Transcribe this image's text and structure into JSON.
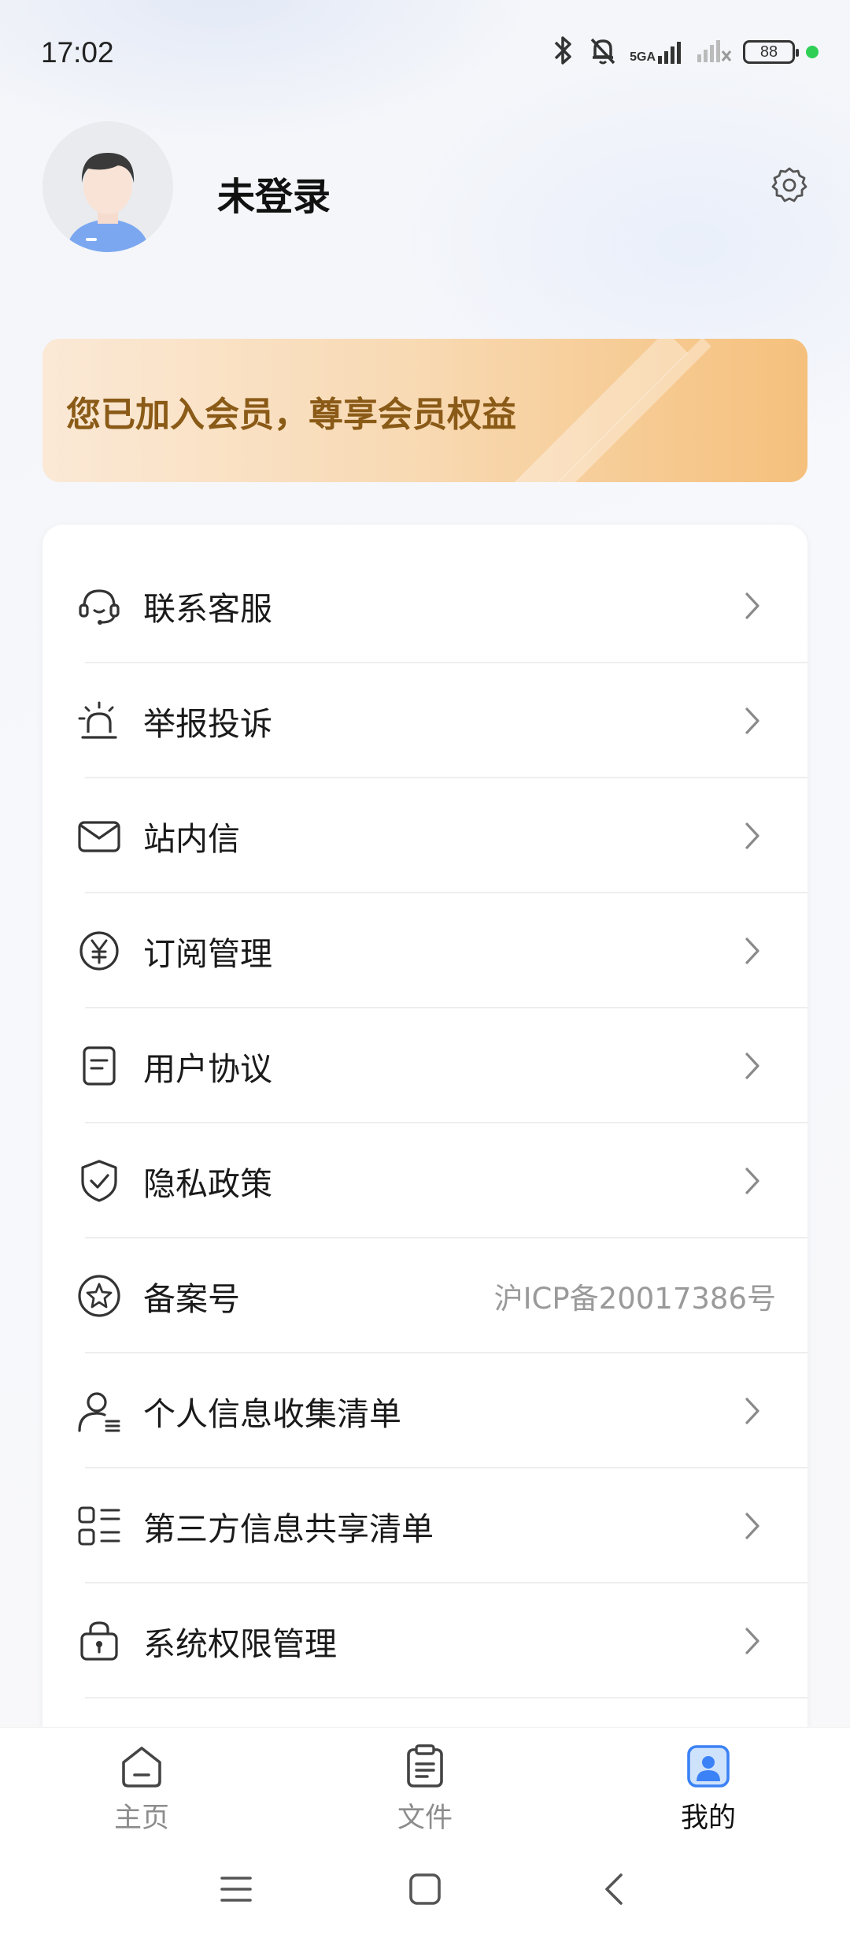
{
  "status_bar": {
    "time": "17:02",
    "network": "5GA",
    "battery": "88"
  },
  "profile": {
    "name": "未登录"
  },
  "member_banner": {
    "text": "您已加入会员，尊享会员权益"
  },
  "menu": {
    "items": [
      {
        "label": "联系客服",
        "icon": "headset-icon"
      },
      {
        "label": "举报投诉",
        "icon": "alarm-icon"
      },
      {
        "label": "站内信",
        "icon": "mail-icon"
      },
      {
        "label": "订阅管理",
        "icon": "yuan-icon"
      },
      {
        "label": "用户协议",
        "icon": "document-icon"
      },
      {
        "label": "隐私政策",
        "icon": "shield-check-icon"
      },
      {
        "label": "备案号",
        "icon": "star-badge-icon",
        "value": "沪ICP备20017386号"
      },
      {
        "label": "个人信息收集清单",
        "icon": "user-list-icon"
      },
      {
        "label": "第三方信息共享清单",
        "icon": "grid-list-icon"
      },
      {
        "label": "系统权限管理",
        "icon": "lock-bag-icon"
      }
    ]
  },
  "bottom_nav": {
    "home": "主页",
    "files": "文件",
    "mine": "我的",
    "active": "mine"
  },
  "colors": {
    "accent": "#3b82f6",
    "member_text": "#8a5a17"
  }
}
